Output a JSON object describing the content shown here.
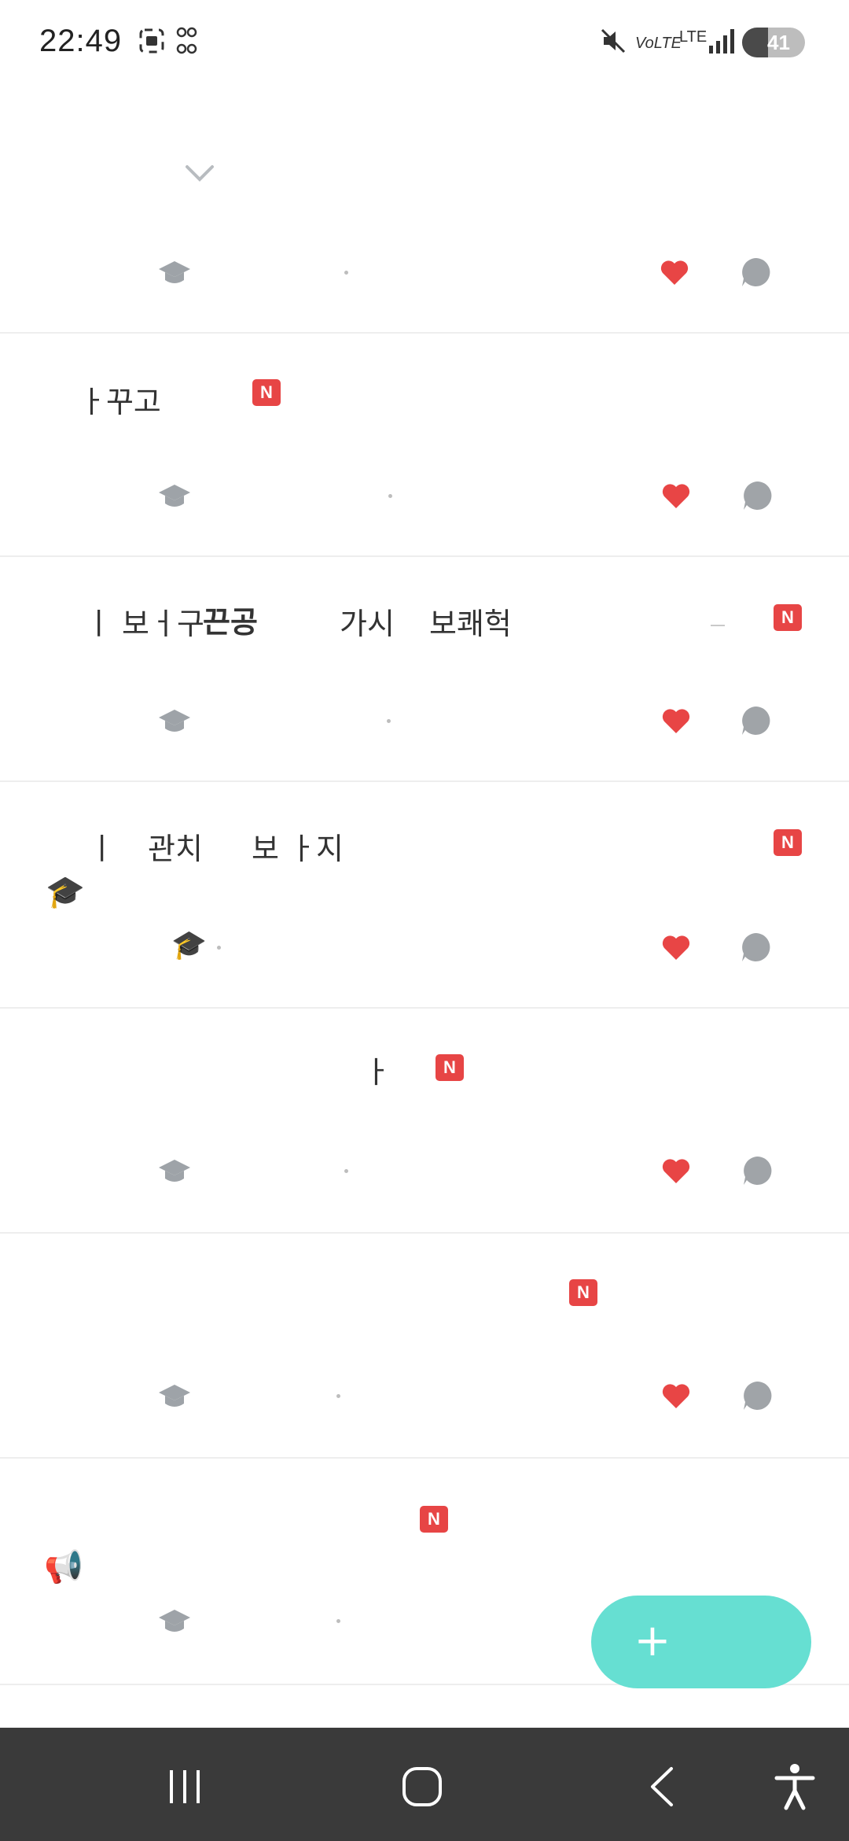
{
  "status_bar": {
    "time": "22:49",
    "network_labels": [
      "VoLTE",
      "LTE"
    ],
    "battery_percent": 41,
    "icons": [
      "screenshot-icon",
      "dot-grid-icon",
      "mute-icon",
      "signal-icon",
      "battery-icon"
    ]
  },
  "feed": {
    "collapse_icon": "chevron-down-icon",
    "posts": [
      {
        "title": "",
        "new": false,
        "emoji": "",
        "liked": true
      },
      {
        "title": "ㅏ꾸고",
        "new": true,
        "new_label": "N",
        "emoji": "",
        "liked": true
      },
      {
        "title_parts": [
          "ㅣ 보ㅓ구",
          "끈공",
          "가시",
          "보쾌헉"
        ],
        "new": true,
        "new_label": "N",
        "emoji": "",
        "liked": true
      },
      {
        "title_parts": [
          "ㅣ",
          "관치",
          "보 ㅏ지"
        ],
        "new": true,
        "new_label": "N",
        "emoji": "🎓",
        "liked": true
      },
      {
        "title": "ㅏ",
        "new": true,
        "new_label": "N",
        "emoji": "",
        "liked": true
      },
      {
        "title": "",
        "new": true,
        "new_label": "N",
        "emoji": "",
        "liked": true
      },
      {
        "title": "",
        "new": true,
        "new_label": "N",
        "emoji": "📢",
        "liked": false
      }
    ]
  },
  "fab": {
    "icon": "plus-icon",
    "label": "+"
  },
  "nav_bar": {
    "buttons": [
      "recent-apps-icon",
      "home-icon",
      "back-icon",
      "accessibility-icon"
    ]
  },
  "colors": {
    "accent": "#66dfd2",
    "badge": "#e74545",
    "heart": "#e84545",
    "muted_icon": "#a0a4a8"
  }
}
